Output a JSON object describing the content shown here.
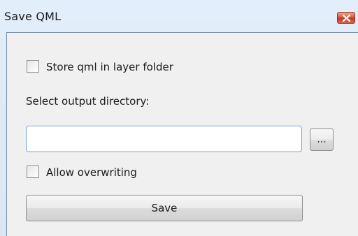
{
  "window": {
    "title": "Save QML",
    "close_icon": "close-icon",
    "accent_color": "#d8533a"
  },
  "form": {
    "store_in_layer_folder": {
      "label": "Store qml in layer folder",
      "checked": false
    },
    "output_directory": {
      "label": "Select output directory:",
      "value": "",
      "placeholder": ""
    },
    "browse_label": "...",
    "allow_overwriting": {
      "label": "Allow overwriting",
      "checked": false
    },
    "save_label": "Save"
  }
}
